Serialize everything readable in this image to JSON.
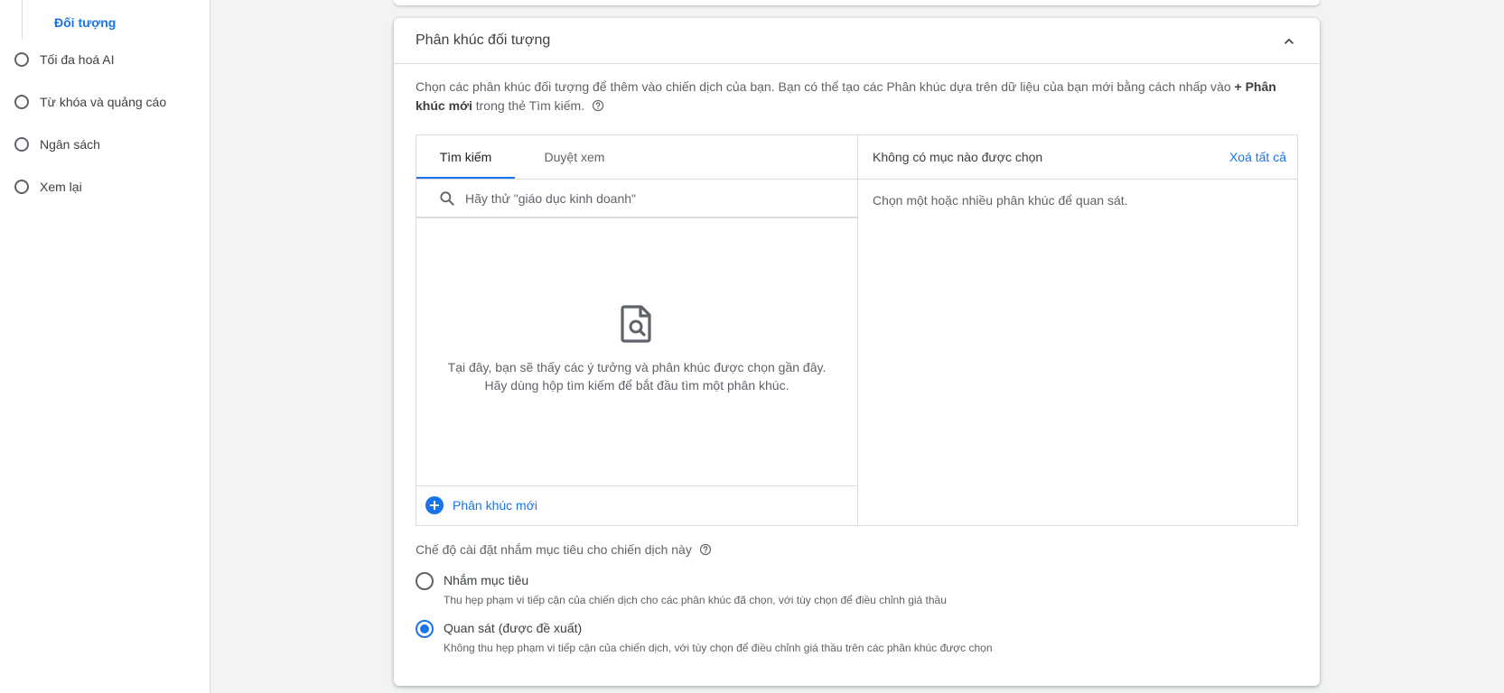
{
  "sidebar": {
    "sub_item": "Đối tượng",
    "steps": [
      {
        "label": "Tối đa hoá AI"
      },
      {
        "label": "Từ khóa và quảng cáo"
      },
      {
        "label": "Ngân sách"
      },
      {
        "label": "Xem lại"
      }
    ]
  },
  "card": {
    "title": "Phân khúc đối tượng",
    "description_part1": "Chọn các phân khúc đối tượng để thêm vào chiến dịch của bạn. Bạn có thể tạo các Phân khúc dựa trên dữ liệu của bạn mới bằng cách nhấp vào",
    "description_bold": "+ Phân khúc mới",
    "description_part2": "trong thẻ Tìm kiếm."
  },
  "picker": {
    "tabs": [
      {
        "label": "Tìm kiếm"
      },
      {
        "label": "Duyệt xem"
      }
    ],
    "active_tab": "Tìm kiếm",
    "search_placeholder": "Hãy thử \"giáo dục kinh doanh\"",
    "search_value": "",
    "empty_line1": "Tại đây, bạn sẽ thấy các ý tưởng và phân khúc được chọn gần đây.",
    "empty_line2": "Hãy dùng hộp tìm kiếm để bắt đầu tìm một phân khúc.",
    "new_segment_label": "Phân khúc mới",
    "right_title": "Không có mục nào được chọn",
    "clear_all": "Xoá tất cả",
    "right_message": "Chọn một hoặc nhiều phân khúc để quan sát."
  },
  "targeting": {
    "label": "Chế độ cài đặt nhắm mục tiêu cho chiến dịch này",
    "options": [
      {
        "title": "Nhắm mục tiêu",
        "subtitle": "Thu hẹp phạm vi tiếp cận của chiến dịch cho các phân khúc đã chọn, với tùy chọn để điều chỉnh giá thầu",
        "selected": false
      },
      {
        "title": "Quan sát (được đề xuất)",
        "subtitle": "Không thu hẹp phạm vi tiếp cận của chiến dịch, với tùy chọn để điều chỉnh giá thầu trên các phân khúc được chọn",
        "selected": true
      }
    ]
  },
  "colors": {
    "accent": "#1a73e8",
    "text": "#3c4043",
    "muted": "#5f6368",
    "border": "#dadce0"
  },
  "icons": [
    "collapse-chevron-up-icon",
    "help-icon",
    "search-icon",
    "document-search-icon",
    "plus-circle-icon"
  ]
}
